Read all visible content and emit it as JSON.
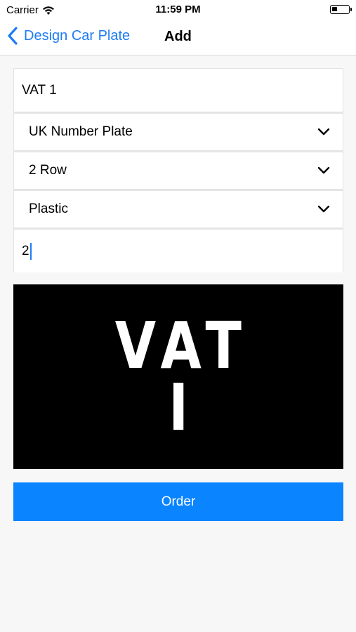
{
  "status_bar": {
    "carrier": "Carrier",
    "time": "11:59 PM"
  },
  "nav": {
    "back_label": "Design Car Plate",
    "title": "Add",
    "accent_color": "#1e7cf5"
  },
  "form": {
    "plate_text": "VAT 1",
    "plate_type": "UK Number Plate",
    "rows": "2 Row",
    "material": "Plastic",
    "quantity": "2"
  },
  "preview": {
    "line1": "VAT",
    "line2": "I"
  },
  "order_button": {
    "label": "Order",
    "color": "#0a84ff"
  }
}
